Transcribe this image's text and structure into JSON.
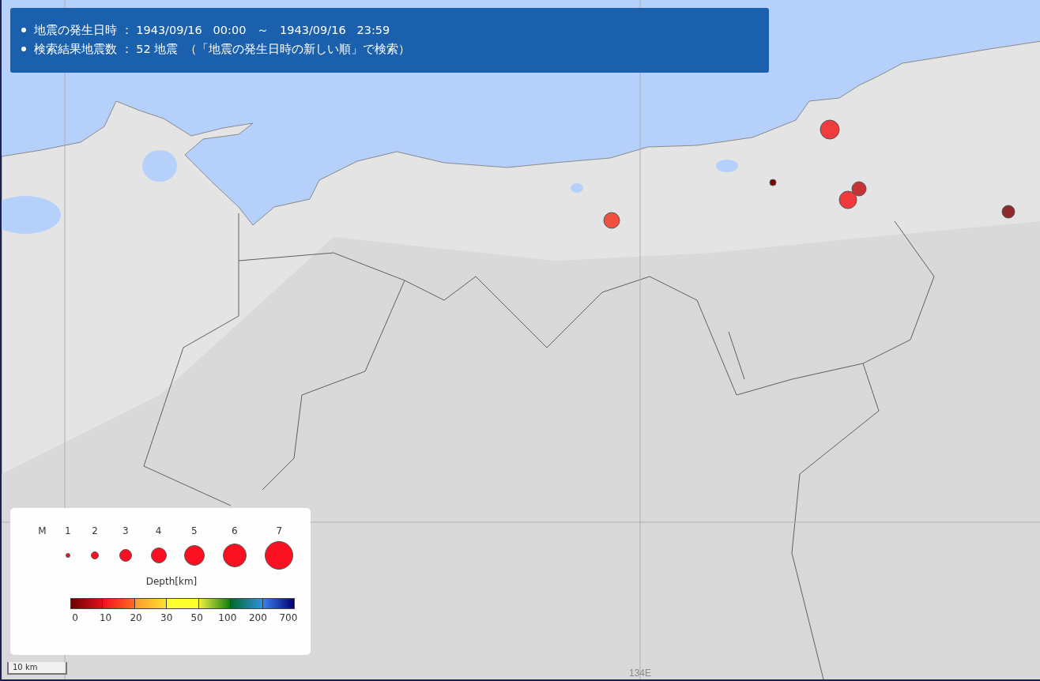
{
  "info_panel": {
    "lines": [
      "地震の発生日時 ： 1943/09/16   00:00   ～   1943/09/16   23:59",
      "検索結果地震数 ： 52 地震  （「地震の発生日時の新しい順」で検索）"
    ]
  },
  "map": {
    "grid_labels": [
      "134E"
    ],
    "earthquakes": [
      {
        "color": "#f03c3c"
      },
      {
        "color": "#800000"
      },
      {
        "color": "#c43434"
      },
      {
        "color": "#f23a3a"
      },
      {
        "color": "#f0503e"
      },
      {
        "color": "#8c2a2a"
      }
    ]
  },
  "legend": {
    "magnitude_label": "M",
    "magnitudes": [
      "1",
      "2",
      "3",
      "4",
      "5",
      "6",
      "7"
    ],
    "depth_title": "Depth[km]",
    "depth_ticks": [
      "0",
      "10",
      "20",
      "30",
      "50",
      "100",
      "200",
      "700"
    ]
  },
  "scale_bar": {
    "label": "10 km"
  }
}
